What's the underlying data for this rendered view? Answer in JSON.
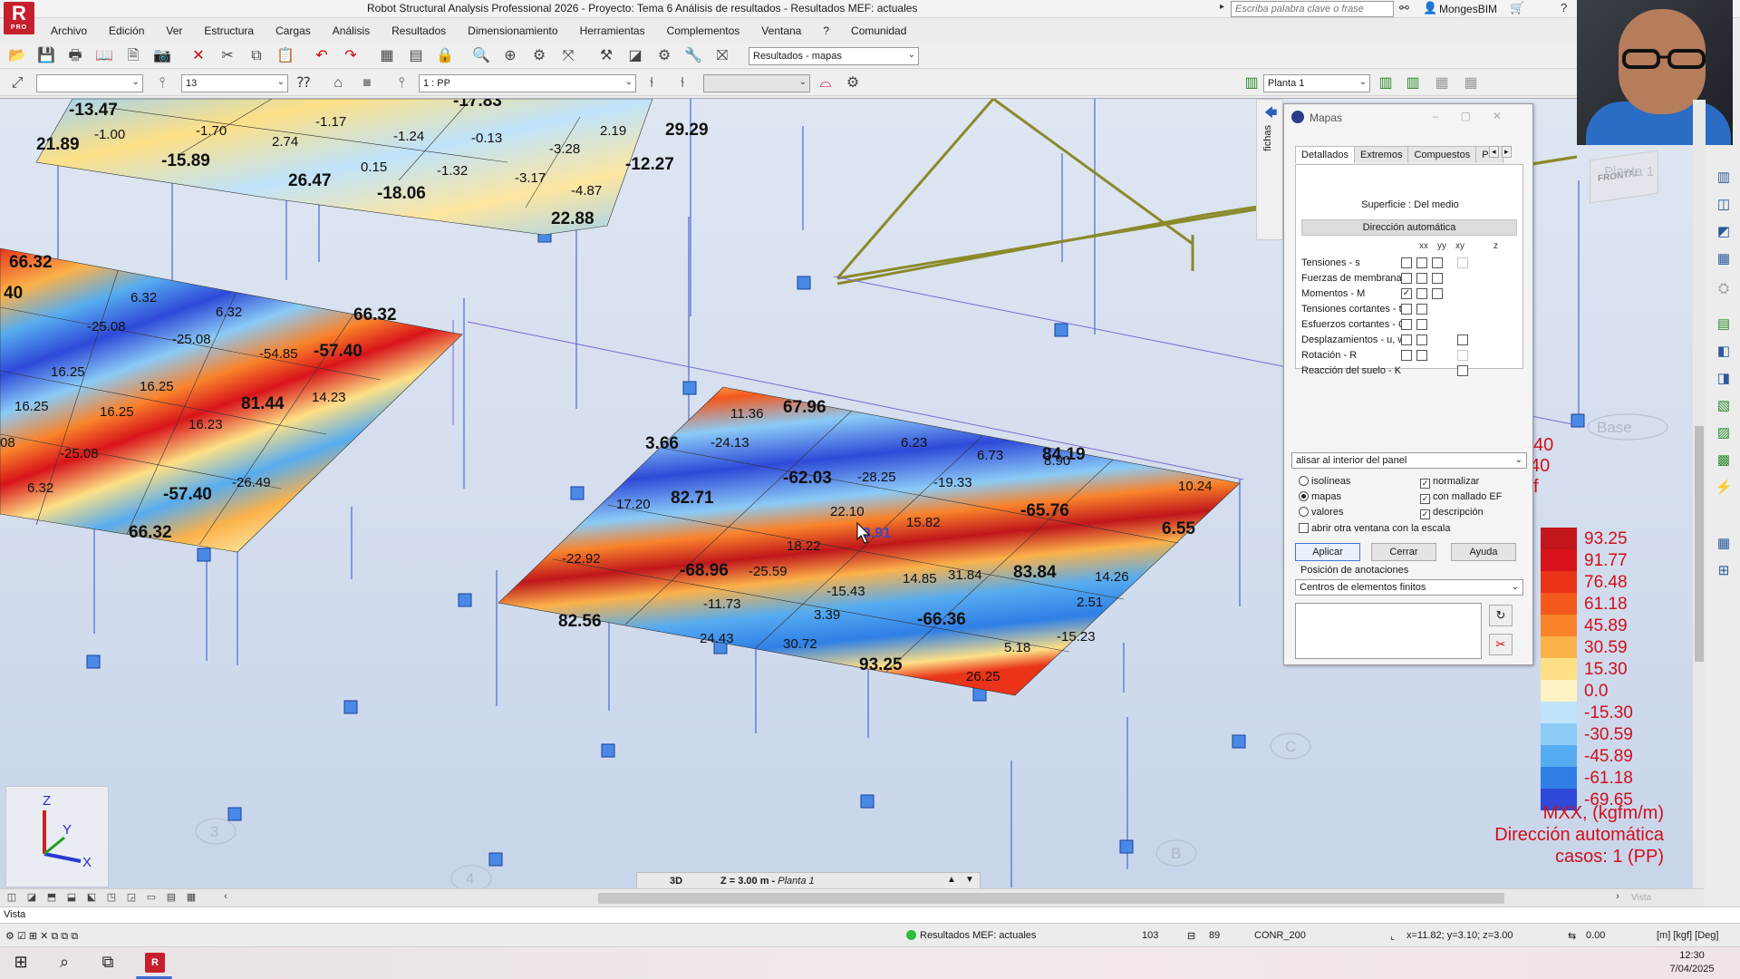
{
  "window": {
    "title": "Robot Structural Analysis Professional 2026 - Proyecto: Tema 6 Análisis de resultados - Resultados MEF: actuales",
    "logo": "R",
    "logo_sub": "PRO",
    "search_placeholder": "Escriba palabra clave o frase",
    "user": "MongesBIM"
  },
  "menu": [
    "Archivo",
    "Edición",
    "Ver",
    "Estructura",
    "Cargas",
    "Análisis",
    "Resultados",
    "Dimensionamiento",
    "Herramientas",
    "Complementos",
    "Ventana",
    "?",
    "Comunidad"
  ],
  "toolbar": {
    "result_selector": "Resultados - mapas",
    "field_13": "13",
    "case_selector": "1 : PP",
    "story_selector": "Planta 1"
  },
  "viewport": {
    "side_tab": "fichas",
    "axes": {
      "x": "X",
      "y": "Y",
      "z": "Z"
    },
    "grid_labels": [
      "3",
      "4",
      "B",
      "C"
    ],
    "grid_labels_faint": [
      "Base",
      "Planta 1"
    ],
    "viewcube_label": "FRONTAL",
    "cursor_value": "3.91",
    "partial_legend": [
      "40",
      "40",
      "f"
    ],
    "slab_labels": [
      {
        "t": "-13.47",
        "b": 1
      },
      {
        "t": "21.89",
        "b": 1
      },
      {
        "t": "-1.00",
        "b": 0
      },
      {
        "t": "-15.89",
        "b": 1
      },
      {
        "t": "-1.17",
        "b": 0
      },
      {
        "t": "-1.70",
        "b": 0
      },
      {
        "t": "2.74",
        "b": 0
      },
      {
        "t": "-1.24",
        "b": 0
      },
      {
        "t": "-0.13",
        "b": 0
      },
      {
        "t": "2.19",
        "b": 0
      },
      {
        "t": "29.29",
        "b": 1
      },
      {
        "t": "-3.28",
        "b": 0
      },
      {
        "t": "-12.27",
        "b": 1
      },
      {
        "t": "0.15",
        "b": 0
      },
      {
        "t": "-1.32",
        "b": 0
      },
      {
        "t": "-3.17",
        "b": 0
      },
      {
        "t": "26.47",
        "b": 1
      },
      {
        "t": "-18.06",
        "b": 1
      },
      {
        "t": "-4.87",
        "b": 0
      },
      {
        "t": "22.88",
        "b": 1
      },
      {
        "t": "-17.83",
        "b": 1
      },
      {
        "t": "66.32",
        "b": 1
      },
      {
        "t": "40",
        "b": 1
      },
      {
        "t": "6.32",
        "b": 0
      },
      {
        "t": "6.32",
        "b": 0
      },
      {
        "t": "66.32",
        "b": 1
      },
      {
        "t": "-25.08",
        "b": 0
      },
      {
        "t": "-25.08",
        "b": 0
      },
      {
        "t": "-54.85",
        "b": 0
      },
      {
        "t": "-57.40",
        "b": 1
      },
      {
        "t": "16.25",
        "b": 0
      },
      {
        "t": "16.25",
        "b": 0
      },
      {
        "t": "16.25",
        "b": 0
      },
      {
        "t": "16.25",
        "b": 0
      },
      {
        "t": "16.23",
        "b": 0
      },
      {
        "t": "81.44",
        "b": 1
      },
      {
        "t": "14.23",
        "b": 0
      },
      {
        "t": "08",
        "b": 0
      },
      {
        "t": "-25.08",
        "b": 0
      },
      {
        "t": "6.32",
        "b": 0
      },
      {
        "t": "-57.40",
        "b": 1
      },
      {
        "t": "-26.49",
        "b": 0
      },
      {
        "t": "66.32",
        "b": 1
      },
      {
        "t": "11.36",
        "b": 0
      },
      {
        "t": "67.96",
        "b": 1
      },
      {
        "t": "3.66",
        "b": 1
      },
      {
        "t": "-24.13",
        "b": 0
      },
      {
        "t": "6.23",
        "b": 0
      },
      {
        "t": "6.73",
        "b": 0
      },
      {
        "t": "84.19",
        "b": 1
      },
      {
        "t": "8.90",
        "b": 0
      },
      {
        "t": "-62.03",
        "b": 1
      },
      {
        "t": "-28.25",
        "b": 0
      },
      {
        "t": "-19.33",
        "b": 0
      },
      {
        "t": "10.24",
        "b": 0
      },
      {
        "t": "17.20",
        "b": 0
      },
      {
        "t": "82.71",
        "b": 1
      },
      {
        "t": "22.10",
        "b": 0
      },
      {
        "t": "15.82",
        "b": 0
      },
      {
        "t": "-65.76",
        "b": 1
      },
      {
        "t": "6.55",
        "b": 1
      },
      {
        "t": "18.22",
        "b": 0
      },
      {
        "t": "-22.92",
        "b": 0
      },
      {
        "t": "-68.96",
        "b": 1
      },
      {
        "t": "-25.59",
        "b": 0
      },
      {
        "t": "14.85",
        "b": 0
      },
      {
        "t": "31.84",
        "b": 0
      },
      {
        "t": "83.84",
        "b": 1
      },
      {
        "t": "14.26",
        "b": 0
      },
      {
        "t": "-11.73",
        "b": 0
      },
      {
        "t": "-15.43",
        "b": 0
      },
      {
        "t": "2.51",
        "b": 0
      },
      {
        "t": "82.56",
        "b": 1
      },
      {
        "t": "3.39",
        "b": 0
      },
      {
        "t": "-66.36",
        "b": 1
      },
      {
        "t": "-15.23",
        "b": 0
      },
      {
        "t": "24.43",
        "b": 0
      },
      {
        "t": "30.72",
        "b": 0
      },
      {
        "t": "5.18",
        "b": 0
      },
      {
        "t": "93.25",
        "b": 1
      },
      {
        "t": "26.25",
        "b": 0
      }
    ]
  },
  "legend": {
    "values": [
      "93.25",
      "91.77",
      "76.48",
      "61.18",
      "45.89",
      "30.59",
      "15.30",
      "0.0",
      "-15.30",
      "-30.59",
      "-45.89",
      "-61.18",
      "-69.65"
    ],
    "colors": [
      "#c0161c",
      "#d8141a",
      "#ea3318",
      "#f4581c",
      "#f9822a",
      "#fbb24a",
      "#fde086",
      "#fdf3c4",
      "#bfe3fb",
      "#8bcbf6",
      "#56acf0",
      "#2f7fe6",
      "#2e49d8"
    ],
    "caption_lines": [
      "MXX, (kgfm/m)",
      "Dirección automática",
      "casos: 1 (PP)"
    ]
  },
  "mapas": {
    "title": "Mapas",
    "tabs": [
      "Detallados",
      "Extremos",
      "Compuestos",
      "Par"
    ],
    "surface": "Superficie : Del medio",
    "dir_button": "Dirección automática",
    "cols": [
      "xx",
      "yy",
      "xy",
      "z"
    ],
    "rows": [
      {
        "label": "Tensiones - s",
        "checked": [
          false,
          false,
          false,
          false
        ]
      },
      {
        "label": "Fuerzas de membrana -",
        "checked": [
          false,
          false,
          false
        ]
      },
      {
        "label": "Momentos - M",
        "checked": [
          true,
          false,
          false
        ]
      },
      {
        "label": "Tensiones cortantes - t",
        "checked": [
          false,
          false
        ]
      },
      {
        "label": "Esfuerzos cortantes - Q",
        "checked": [
          false,
          false
        ]
      },
      {
        "label": "Desplazamientos - u, w",
        "checked": [
          false,
          false,
          false
        ]
      },
      {
        "label": "Rotación - R",
        "checked": [
          false,
          false,
          false
        ]
      },
      {
        "label": "Reacción del suelo - K",
        "checked": [
          false
        ]
      }
    ],
    "smoothing": "alisar al interior del panel",
    "radio_options": [
      "isolíneas",
      "mapas",
      "valores"
    ],
    "check_options": [
      "normalizar",
      "con mallado EF",
      "descripción"
    ],
    "open_window": "abrir otra ventana con la escala",
    "buttons": {
      "apply": "Aplicar",
      "close": "Cerrar",
      "help": "Ayuda"
    },
    "anno_title": "Posición de anotaciones",
    "anno_select": "Centros de elementos finitos"
  },
  "bottom": {
    "cut_mode": "3D",
    "cut_level": "Z = 3.00 m - ",
    "cut_story": "Planta 1",
    "cmdline": "Vista",
    "faint_tab": "Vista",
    "status_results": "Resultados MEF: actuales",
    "status_103": "103",
    "status_89": "89",
    "status_conr": "CONR_200",
    "status_coords": "x=11.82; y=3.10; z=3.00",
    "status_angle": "0.00",
    "status_units": "[m] [kgf] [Deg]",
    "time": "12:30",
    "date": "7/04/2025"
  }
}
